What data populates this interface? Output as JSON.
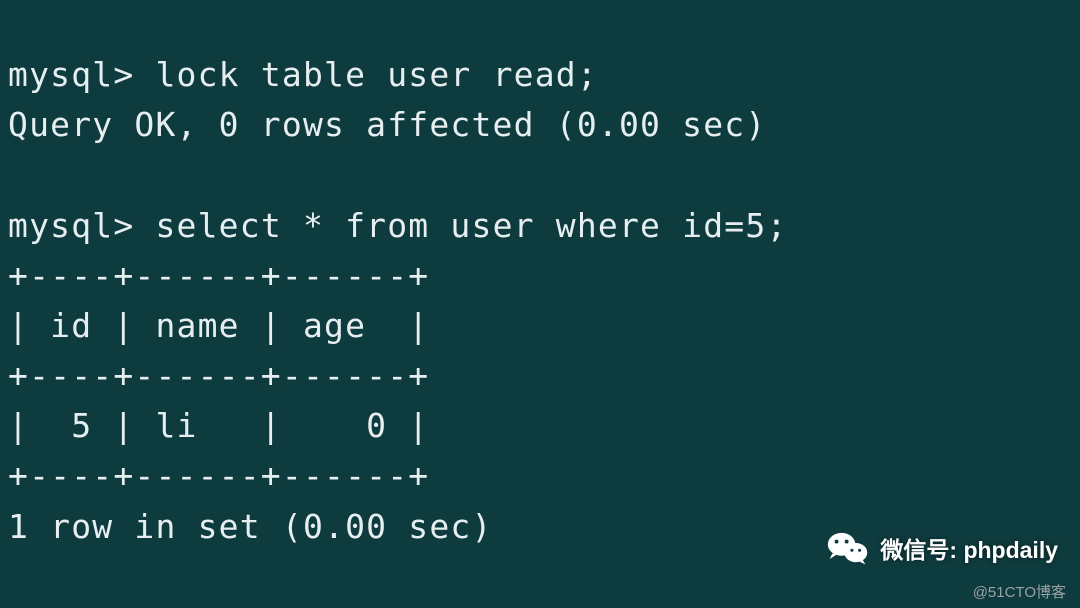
{
  "terminal": {
    "prompt": "mysql>",
    "cmd1": "lock table user read;",
    "res1": "Query OK, 0 rows affected (0.00 sec)",
    "blank": "",
    "cmd2": "select * from user where id=5;",
    "tbl_top": "+----+------+------+",
    "tbl_header": "| id | name | age  |",
    "tbl_mid": "+----+------+------+",
    "tbl_row": "|  5 | li   |    0 |",
    "tbl_bot": "+----+------+------+",
    "res2": "1 row in set (0.00 sec)"
  },
  "watermark": {
    "label": "微信号:",
    "handle": "phpdaily"
  },
  "attribution": "@51CTO博客",
  "chart_data": {
    "type": "table",
    "columns": [
      "id",
      "name",
      "age"
    ],
    "rows": [
      {
        "id": 5,
        "name": "li",
        "age": 0
      }
    ],
    "query": "select * from user where id=5;",
    "result_summary": "1 row in set (0.00 sec)"
  }
}
